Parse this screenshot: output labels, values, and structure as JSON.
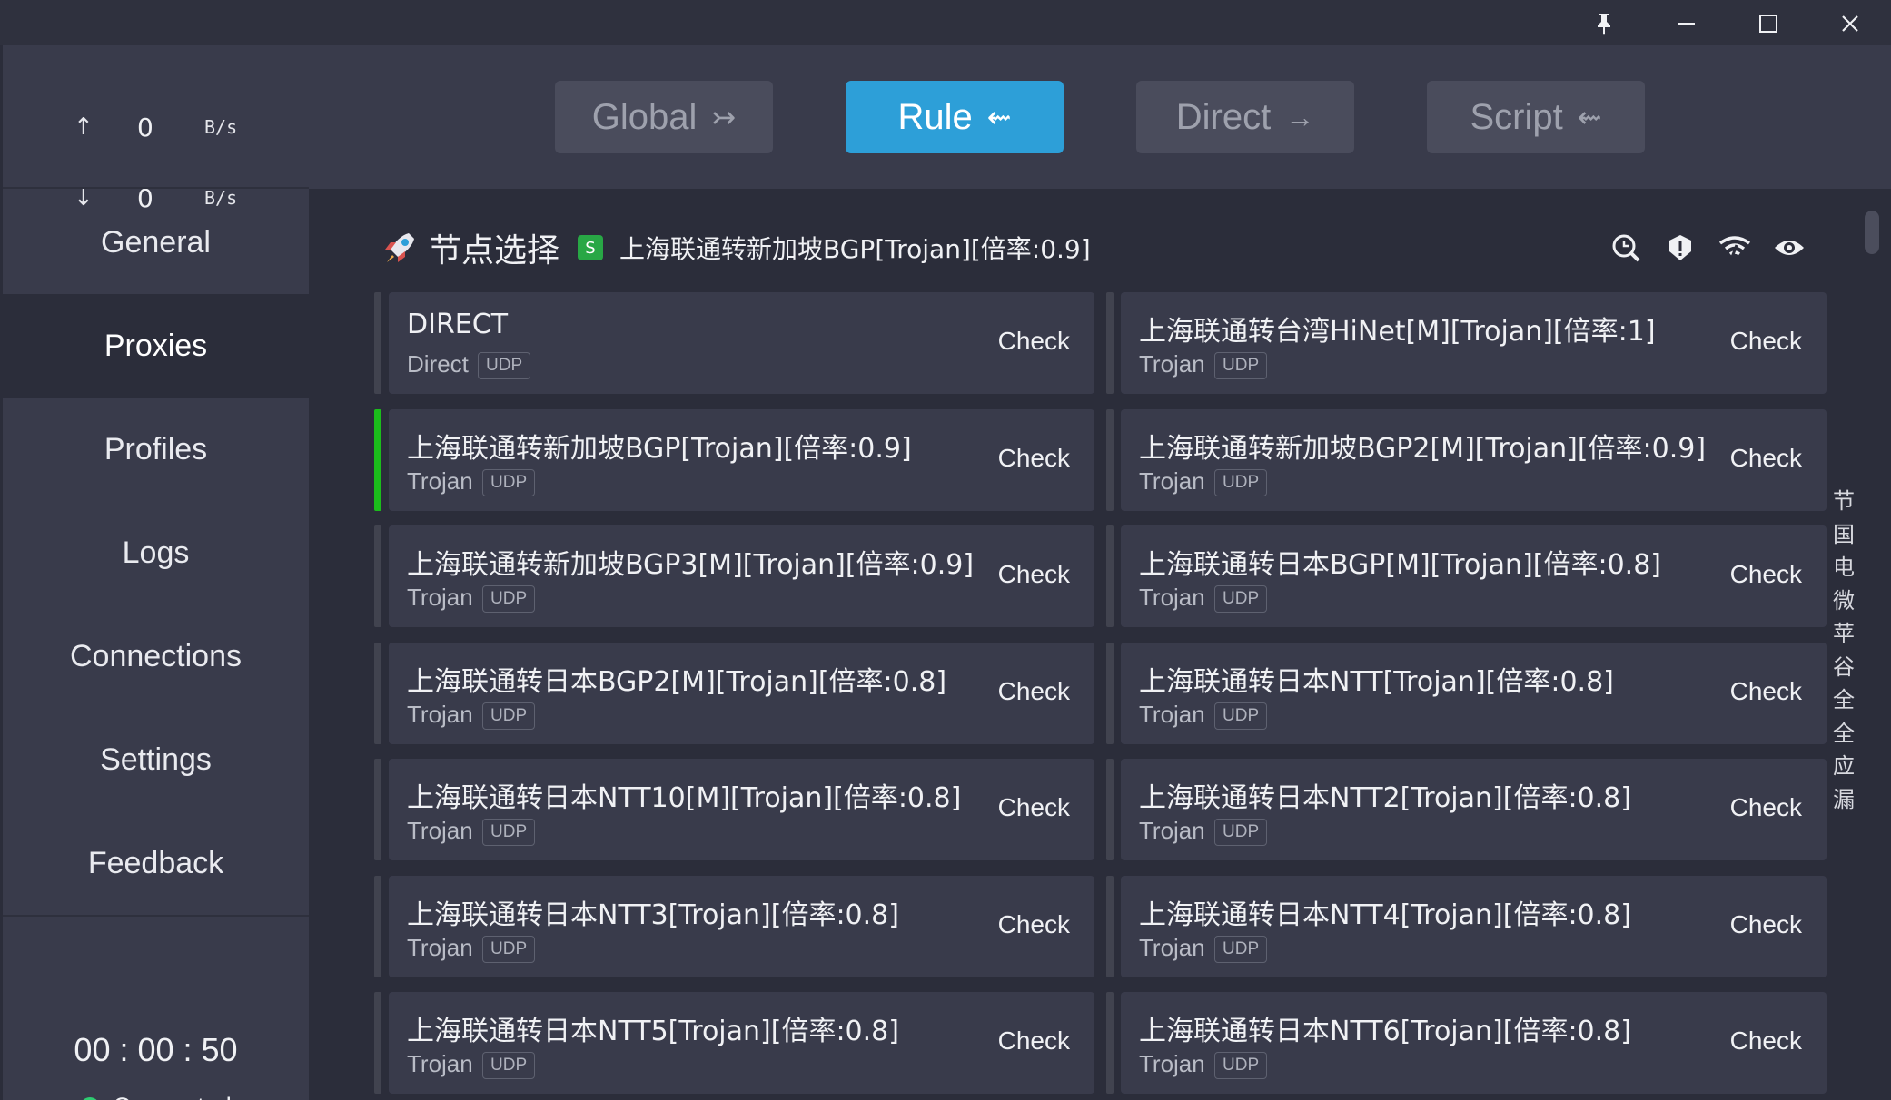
{
  "window": {
    "pin_icon": "pin-icon",
    "minimize_label": "–",
    "maximize_label": "☐",
    "close_label": "✕"
  },
  "traffic": {
    "upload_arrow": "↑",
    "upload_value": "0",
    "upload_unit": "B/s",
    "download_arrow": "↓",
    "download_value": "0",
    "download_unit": "B/s"
  },
  "nav": {
    "items": [
      {
        "label": "General"
      },
      {
        "label": "Proxies"
      },
      {
        "label": "Profiles"
      },
      {
        "label": "Logs"
      },
      {
        "label": "Connections"
      },
      {
        "label": "Settings"
      },
      {
        "label": "Feedback"
      }
    ],
    "active": "Proxies"
  },
  "status": {
    "timer": "00 : 00 : 50",
    "connection": "Connected",
    "connection_color": "#2ecc71"
  },
  "modes": [
    {
      "label": "Global",
      "icon": "↣"
    },
    {
      "label": "Rule",
      "icon": "⇜"
    },
    {
      "label": "Direct",
      "icon": "→"
    },
    {
      "label": "Script",
      "icon": "⇜"
    }
  ],
  "active_mode": "Rule",
  "accent_color": "#2d9fd8",
  "group": {
    "name": "节点选择",
    "badge": "S",
    "current": "上海联通转新加坡BGP[Trojan][倍率:0.9]",
    "icons": [
      "search-latency-icon",
      "alert-icon",
      "wifi-icon",
      "eye-icon"
    ]
  },
  "proxies": [
    {
      "name": "DIRECT",
      "type": "Direct",
      "udp": "UDP",
      "check": "Check",
      "selected": false
    },
    {
      "name": "上海联通转台湾HiNet[M][Trojan][倍率:1]",
      "type": "Trojan",
      "udp": "UDP",
      "check": "Check",
      "selected": false
    },
    {
      "name": "上海联通转新加坡BGP[Trojan][倍率:0.9]",
      "type": "Trojan",
      "udp": "UDP",
      "check": "Check",
      "selected": true
    },
    {
      "name": "上海联通转新加坡BGP2[M][Trojan][倍率:0.9]",
      "type": "Trojan",
      "udp": "UDP",
      "check": "Check",
      "selected": false
    },
    {
      "name": "上海联通转新加坡BGP3[M][Trojan][倍率:0.9]",
      "type": "Trojan",
      "udp": "UDP",
      "check": "Check",
      "selected": false
    },
    {
      "name": "上海联通转日本BGP[M][Trojan][倍率:0.8]",
      "type": "Trojan",
      "udp": "UDP",
      "check": "Check",
      "selected": false
    },
    {
      "name": "上海联通转日本BGP2[M][Trojan][倍率:0.8]",
      "type": "Trojan",
      "udp": "UDP",
      "check": "Check",
      "selected": false
    },
    {
      "name": "上海联通转日本NTT[Trojan][倍率:0.8]",
      "type": "Trojan",
      "udp": "UDP",
      "check": "Check",
      "selected": false
    },
    {
      "name": "上海联通转日本NTT10[M][Trojan][倍率:0.8]",
      "type": "Trojan",
      "udp": "UDP",
      "check": "Check",
      "selected": false
    },
    {
      "name": "上海联通转日本NTT2[Trojan][倍率:0.8]",
      "type": "Trojan",
      "udp": "UDP",
      "check": "Check",
      "selected": false
    },
    {
      "name": "上海联通转日本NTT3[Trojan][倍率:0.8]",
      "type": "Trojan",
      "udp": "UDP",
      "check": "Check",
      "selected": false
    },
    {
      "name": "上海联通转日本NTT4[Trojan][倍率:0.8]",
      "type": "Trojan",
      "udp": "UDP",
      "check": "Check",
      "selected": false
    },
    {
      "name": "上海联通转日本NTT5[Trojan][倍率:0.8]",
      "type": "Trojan",
      "udp": "UDP",
      "check": "Check",
      "selected": false
    },
    {
      "name": "上海联通转日本NTT6[Trojan][倍率:0.8]",
      "type": "Trojan",
      "udp": "UDP",
      "check": "Check",
      "selected": false
    }
  ],
  "group_index": [
    "节",
    "国",
    "电",
    "微",
    "苹",
    "谷",
    "全",
    "全",
    "应",
    "漏"
  ]
}
